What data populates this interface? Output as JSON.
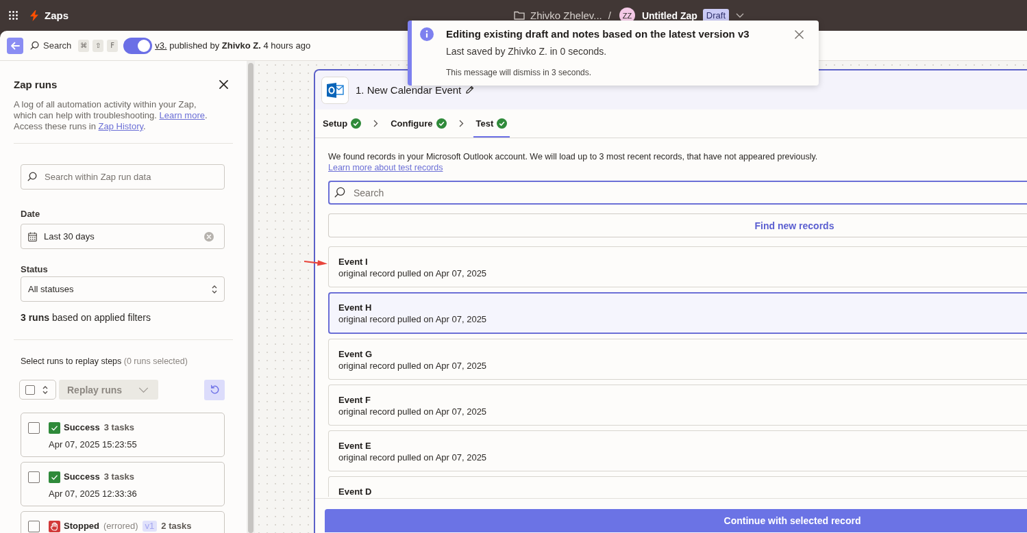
{
  "top_bar": {
    "app_title": "Zaps",
    "folder": "Zhivko Zhelev...",
    "separator": "/",
    "avatar_initials": "ZZ",
    "zap_name": "Untitled Zap",
    "badge": "Draft"
  },
  "toolbar": {
    "search_label": "Search",
    "shortcut_keys": [
      "⌘",
      "⇧",
      "F"
    ],
    "toggle": {
      "on": true
    },
    "version_link": "v3.",
    "published_text": "published by **Zhivko Z.** 4 hours ago"
  },
  "toast": {
    "title": "Editing existing draft and notes based on the latest version v3",
    "message": "Last saved by Zhivko Z. in 0 seconds.",
    "note": "This message will dismiss in 3 seconds."
  },
  "zap_runs_panel": {
    "title": "Zap runs",
    "description": [
      {
        "kind": "text",
        "text": "A log of all automation activity within your Zap, which can help with troubleshooting. "
      },
      {
        "kind": "link",
        "text": "Learn more"
      },
      {
        "kind": "text",
        "text": ". Access these runs in "
      },
      {
        "kind": "link",
        "text": "Zap History"
      },
      {
        "kind": "text",
        "text": "."
      }
    ],
    "search": {
      "placeholder": "Search within Zap run data"
    },
    "date_filter": {
      "label": "Date",
      "value": "Last 30 days"
    },
    "status_filter": {
      "label": "Status",
      "value": "All statuses"
    },
    "result_summary": "**3 runs** based on applied filters",
    "replay_heading": "Select runs to replay steps",
    "selected_count": "(0 runs selected)",
    "select_all": {
      "checked": false
    },
    "replay_button": {
      "label": "Replay runs",
      "disabled": true
    },
    "runs": [
      {
        "kind": "success",
        "status": "Success",
        "tasks": "3 tasks",
        "time": "Apr 07, 2025 15:23:55",
        "checked": false
      },
      {
        "kind": "success",
        "status": "Success",
        "tasks": "3 tasks",
        "time": "Apr 07, 2025 12:33:36",
        "checked": false
      },
      {
        "kind": "stopped",
        "status": "Stopped",
        "detail": "(errored)",
        "version": "v1",
        "tasks": "2 tasks",
        "checked": false
      }
    ]
  },
  "step": {
    "title": "1. New Calendar Event",
    "tabs": [
      {
        "label": "Setup",
        "done": true,
        "selected": false
      },
      {
        "label": "Configure",
        "done": true,
        "selected": false
      },
      {
        "label": "Test",
        "done": true,
        "selected": true
      }
    ],
    "intro": "We found records in your Microsoft Outlook account. We will load up to 3 most recent records, that have not appeared previously.",
    "intro_link": "Learn more about test records",
    "search": {
      "placeholder": "Search"
    },
    "find_button": "Find new records",
    "records": [
      {
        "title": "Event I",
        "subtitle": "original record pulled on Apr 07, 2025",
        "selected": false
      },
      {
        "title": "Event H",
        "subtitle": "original record pulled on Apr 07, 2025",
        "selected": true
      },
      {
        "title": "Event G",
        "subtitle": "original record pulled on Apr 07, 2025",
        "selected": false
      },
      {
        "title": "Event F",
        "subtitle": "original record pulled on Apr 07, 2025",
        "selected": false
      },
      {
        "title": "Event E",
        "subtitle": "original record pulled on Apr 07, 2025",
        "selected": false
      },
      {
        "title": "Event D",
        "selected": false
      }
    ],
    "continue_button": "Continue with selected record"
  }
}
